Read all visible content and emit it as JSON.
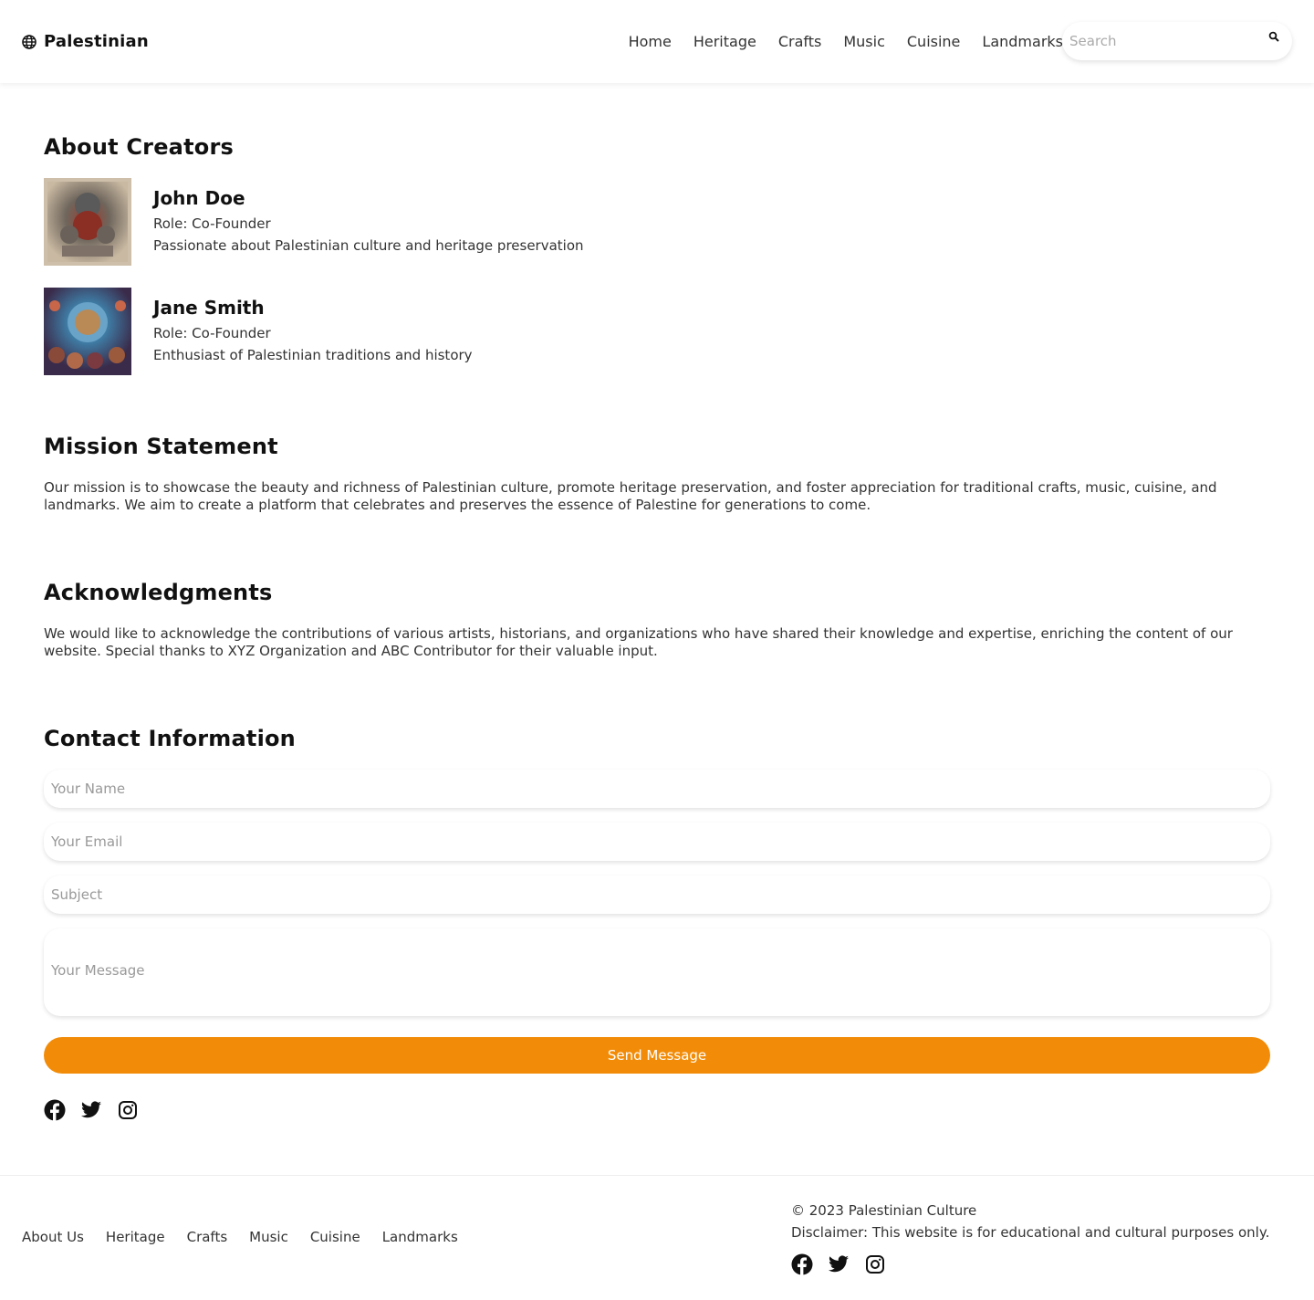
{
  "header": {
    "brand": "Palestinian",
    "brand_icon": "globe-icon",
    "nav": [
      "Home",
      "Heritage",
      "Crafts",
      "Music",
      "Cuisine",
      "Landmarks"
    ],
    "search_placeholder": "Search",
    "search_icon": "search-icon"
  },
  "about": {
    "title": "About Creators",
    "creators": [
      {
        "name": "John Doe",
        "role": "Role: Co-Founder",
        "desc": "Passionate about Palestinian culture and heritage preservation"
      },
      {
        "name": "Jane Smith",
        "role": "Role: Co-Founder",
        "desc": "Enthusiast of Palestinian traditions and history"
      }
    ]
  },
  "mission": {
    "title": "Mission Statement",
    "text": "Our mission is to showcase the beauty and richness of Palestinian culture, promote heritage preservation, and foster appreciation for traditional crafts, music, cuisine, and landmarks. We aim to create a platform that celebrates and preserves the essence of Palestine for generations to come."
  },
  "acknowledgments": {
    "title": "Acknowledgments",
    "text": "We would like to acknowledge the contributions of various artists, historians, and organizations who have shared their knowledge and expertise, enriching the content of our website. Special thanks to XYZ Organization and ABC Contributor for their valuable input."
  },
  "contact": {
    "title": "Contact Information",
    "name_placeholder": "Your Name",
    "email_placeholder": "Your Email",
    "subject_placeholder": "Subject",
    "message_placeholder": "Your Message",
    "send_label": "Send Message"
  },
  "colors": {
    "accent": "#f28c08"
  },
  "footer": {
    "links": [
      "About Us",
      "Heritage",
      "Crafts",
      "Music",
      "Cuisine",
      "Landmarks"
    ],
    "copyright": "© 2023 Palestinian Culture",
    "disclaimer": "Disclaimer: This website is for educational and cultural purposes only."
  },
  "social_icons": [
    "facebook-icon",
    "twitter-icon",
    "instagram-icon"
  ]
}
